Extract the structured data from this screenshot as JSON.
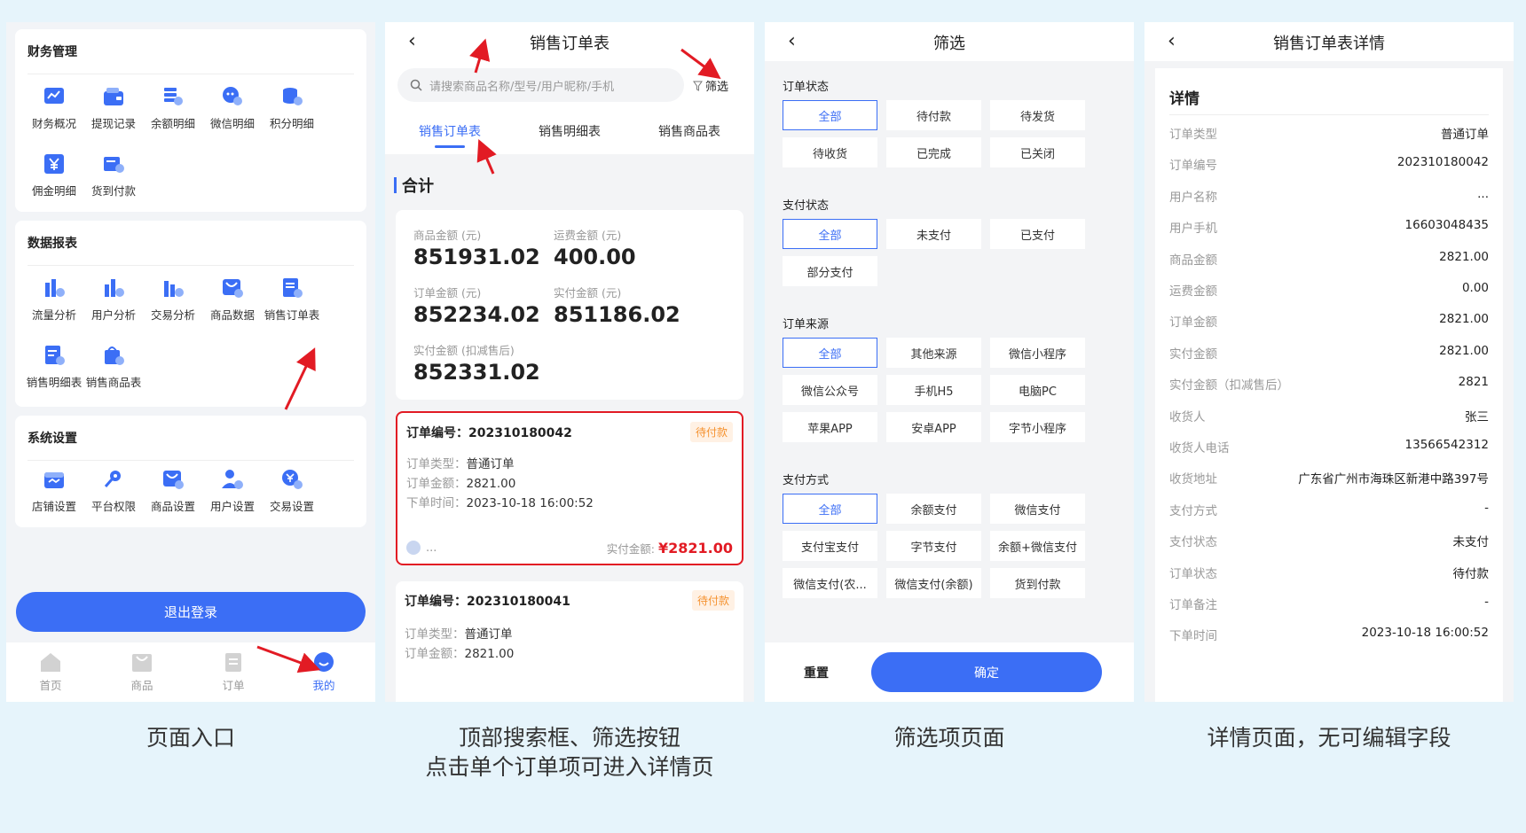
{
  "panel1": {
    "finance": {
      "title": "财务管理",
      "items": [
        {
          "label": "财务概况",
          "icon": "finance-overview-icon"
        },
        {
          "label": "提现记录",
          "icon": "wallet-icon"
        },
        {
          "label": "余额明细",
          "icon": "balance-icon"
        },
        {
          "label": "微信明细",
          "icon": "wechat-icon"
        },
        {
          "label": "积分明细",
          "icon": "points-icon"
        },
        {
          "label": "佣金明细",
          "icon": "yen-icon"
        },
        {
          "label": "货到付款",
          "icon": "cod-icon"
        }
      ]
    },
    "reports": {
      "title": "数据报表",
      "items": [
        {
          "label": "流量分析",
          "icon": "traffic-chart-icon"
        },
        {
          "label": "用户分析",
          "icon": "user-chart-icon"
        },
        {
          "label": "交易分析",
          "icon": "trade-chart-icon"
        },
        {
          "label": "商品数据",
          "icon": "goods-data-icon"
        },
        {
          "label": "销售订单表",
          "icon": "sales-order-icon"
        },
        {
          "label": "销售明细表",
          "icon": "sales-detail-icon"
        },
        {
          "label": "销售商品表",
          "icon": "sales-goods-icon"
        }
      ]
    },
    "settings": {
      "title": "系统设置",
      "items": [
        {
          "label": "店铺设置",
          "icon": "store-icon"
        },
        {
          "label": "平台权限",
          "icon": "key-icon"
        },
        {
          "label": "商品设置",
          "icon": "goods-setting-icon"
        },
        {
          "label": "用户设置",
          "icon": "user-setting-icon"
        },
        {
          "label": "交易设置",
          "icon": "trade-setting-icon"
        }
      ]
    },
    "logout": "退出登录",
    "tabs": [
      {
        "label": "首页",
        "icon": "home-icon"
      },
      {
        "label": "商品",
        "icon": "bag-icon"
      },
      {
        "label": "订单",
        "icon": "order-icon"
      },
      {
        "label": "我的",
        "icon": "profile-icon"
      }
    ]
  },
  "panel2": {
    "title": "销售订单表",
    "search_placeholder": "请搜索商品名称/型号/用户昵称/手机",
    "filter_label": "筛选",
    "tabs": [
      "销售订单表",
      "销售明细表",
      "销售商品表"
    ],
    "summary_title": "合计",
    "stats": [
      {
        "label": "商品金额 (元)",
        "value": "851931.02"
      },
      {
        "label": "运费金额 (元)",
        "value": "400.00"
      },
      {
        "label": "订单金额 (元)",
        "value": "852234.02"
      },
      {
        "label": "实付金额 (元)",
        "value": "851186.02"
      },
      {
        "label": "实付金额 (扣减售后)",
        "value": "852331.02"
      }
    ],
    "orders": [
      {
        "id": "订单编号：202310180042",
        "status": "待付款",
        "type_label": "订单类型：",
        "type": "普通订单",
        "amount_label": "订单金额：",
        "amount": "2821.00",
        "time_label": "下单时间：",
        "time": "2023-10-18 16:00:52",
        "user": "...",
        "paid_label": "实付金额:",
        "paid": "¥2821.00"
      },
      {
        "id": "订单编号：202310180041",
        "status": "待付款",
        "type_label": "订单类型：",
        "type": "普通订单",
        "amount_label": "订单金额：",
        "amount": "2821.00"
      }
    ]
  },
  "panel3": {
    "title": "筛选",
    "sections": [
      {
        "title": "订单状态",
        "options": [
          "全部",
          "待付款",
          "待发货",
          "待收货",
          "已完成",
          "已关闭"
        ]
      },
      {
        "title": "支付状态",
        "options": [
          "全部",
          "未支付",
          "已支付",
          "部分支付"
        ]
      },
      {
        "title": "订单来源",
        "options": [
          "全部",
          "其他来源",
          "微信小程序",
          "微信公众号",
          "手机H5",
          "电脑PC",
          "苹果APP",
          "安卓APP",
          "字节小程序"
        ]
      },
      {
        "title": "支付方式",
        "options": [
          "全部",
          "余额支付",
          "微信支付",
          "支付宝支付",
          "字节支付",
          "余额+微信支付",
          "微信支付(农...",
          "微信支付(余额)",
          "货到付款"
        ]
      }
    ],
    "reset": "重置",
    "confirm": "确定"
  },
  "panel4": {
    "title": "销售订单表详情",
    "section": "详情",
    "rows": [
      {
        "k": "订单类型",
        "v": "普通订单"
      },
      {
        "k": "订单编号",
        "v": "202310180042"
      },
      {
        "k": "用户名称",
        "v": "..."
      },
      {
        "k": "用户手机",
        "v": "16603048435"
      },
      {
        "k": "商品金额",
        "v": "2821.00"
      },
      {
        "k": "运费金额",
        "v": "0.00"
      },
      {
        "k": "订单金额",
        "v": "2821.00"
      },
      {
        "k": "实付金额",
        "v": "2821.00"
      },
      {
        "k": "实付金额（扣减售后）",
        "v": "2821"
      },
      {
        "k": "收货人",
        "v": "张三"
      },
      {
        "k": "收货人电话",
        "v": "13566542312"
      },
      {
        "k": "收货地址",
        "v": "广东省广州市海珠区新港中路397号"
      },
      {
        "k": "支付方式",
        "v": "-"
      },
      {
        "k": "支付状态",
        "v": "未支付"
      },
      {
        "k": "订单状态",
        "v": "待付款"
      },
      {
        "k": "订单备注",
        "v": "-"
      },
      {
        "k": "下单时间",
        "v": "2023-10-18 16:00:52"
      }
    ]
  },
  "captions": {
    "c1": "页面入口",
    "c2a": "顶部搜索框、筛选按钮",
    "c2b": "点击单个订单项可进入详情页",
    "c3": "筛选项页面",
    "c4": "详情页面，无可编辑字段"
  },
  "colors": {
    "accent": "#3b6ef5",
    "highlight": "#e21b24",
    "warning": "#f5922f"
  }
}
